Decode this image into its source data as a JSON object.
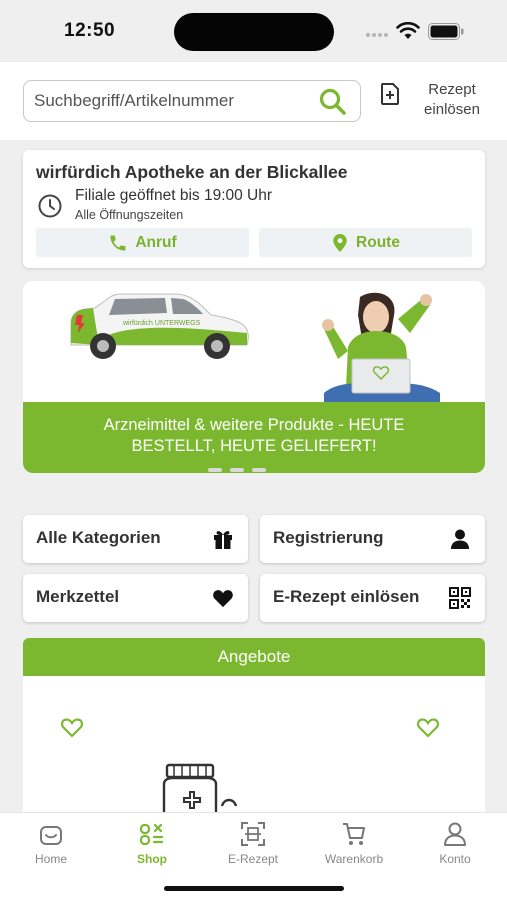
{
  "status_bar": {
    "time": "12:50"
  },
  "search": {
    "placeholder": "Suchbegriff/Artikelnummer"
  },
  "rezept": {
    "label_line1": "Rezept",
    "label_line2": "einlösen"
  },
  "store": {
    "name": "wirfürdich Apotheke an der Blickallee",
    "hours": "Filiale geöffnet bis 19:00 Uhr",
    "hours_link": "Alle Öffnungszeiten",
    "call_label": "Anruf",
    "route_label": "Route"
  },
  "banner": {
    "text_line1": "Arzneimittel & weitere Produkte - HEUTE",
    "text_line2": "BESTELLT, HEUTE GELIEFERT!",
    "van_text": "wirfürdich UNTERWEGS"
  },
  "tiles": [
    {
      "label": "Alle Kategorien",
      "icon": "gift-icon"
    },
    {
      "label": "Registrierung",
      "icon": "user-icon"
    },
    {
      "label": "Merkzettel",
      "icon": "heart-icon"
    },
    {
      "label": "E-Rezept einlösen",
      "icon": "qr-code-icon"
    }
  ],
  "offers": {
    "title": "Angebote"
  },
  "tab_bar": {
    "items": [
      {
        "label": "Home",
        "icon": "home-icon",
        "active": false
      },
      {
        "label": "Shop",
        "icon": "shop-icon",
        "active": true
      },
      {
        "label": "E-Rezept",
        "icon": "scan-icon",
        "active": false
      },
      {
        "label": "Warenkorb",
        "icon": "cart-icon",
        "active": false
      },
      {
        "label": "Konto",
        "icon": "account-icon",
        "active": false
      }
    ]
  },
  "colors": {
    "accent": "#7cb82f",
    "background": "#efefef",
    "button_bg": "#eff2f5"
  }
}
